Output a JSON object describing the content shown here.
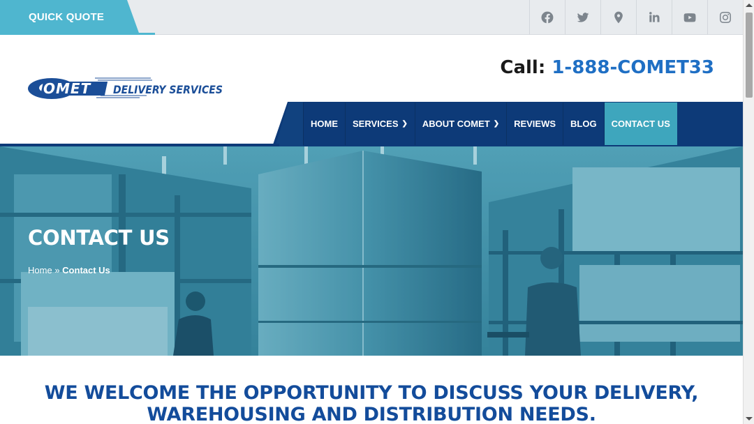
{
  "topbar": {
    "quick_quote": "QUICK QUOTE",
    "social_icons": [
      "facebook-icon",
      "twitter-icon",
      "map-pin-icon",
      "linkedin-icon",
      "youtube-icon",
      "instagram-icon"
    ]
  },
  "header": {
    "logo_text": "OMET",
    "logo_tagline": "DELIVERY SERVICES",
    "call_label": "Call:",
    "phone": "1-888-COMET33"
  },
  "nav": {
    "items": [
      {
        "label": "HOME",
        "dropdown": false
      },
      {
        "label": "SERVICES",
        "dropdown": true
      },
      {
        "label": "ABOUT COMET",
        "dropdown": true
      },
      {
        "label": "REVIEWS",
        "dropdown": false
      },
      {
        "label": "BLOG",
        "dropdown": false
      },
      {
        "label": "CONTACT US",
        "dropdown": false,
        "active": true
      }
    ],
    "search_icon": "search-icon"
  },
  "hero": {
    "title": "CONTACT US",
    "breadcrumb_home": "Home",
    "breadcrumb_sep": "»",
    "breadcrumb_current": "Contact Us"
  },
  "main": {
    "heading_line1": "WE WELCOME THE OPPORTUNITY TO DISCUSS YOUR DELIVERY,",
    "heading_line2": "WAREHOUSING AND DISTRIBUTION NEEDS."
  },
  "colors": {
    "navy": "#0d3a78",
    "teal": "#3ea6bd",
    "phone_blue": "#1f6fc4",
    "heading_blue": "#134c9b"
  }
}
